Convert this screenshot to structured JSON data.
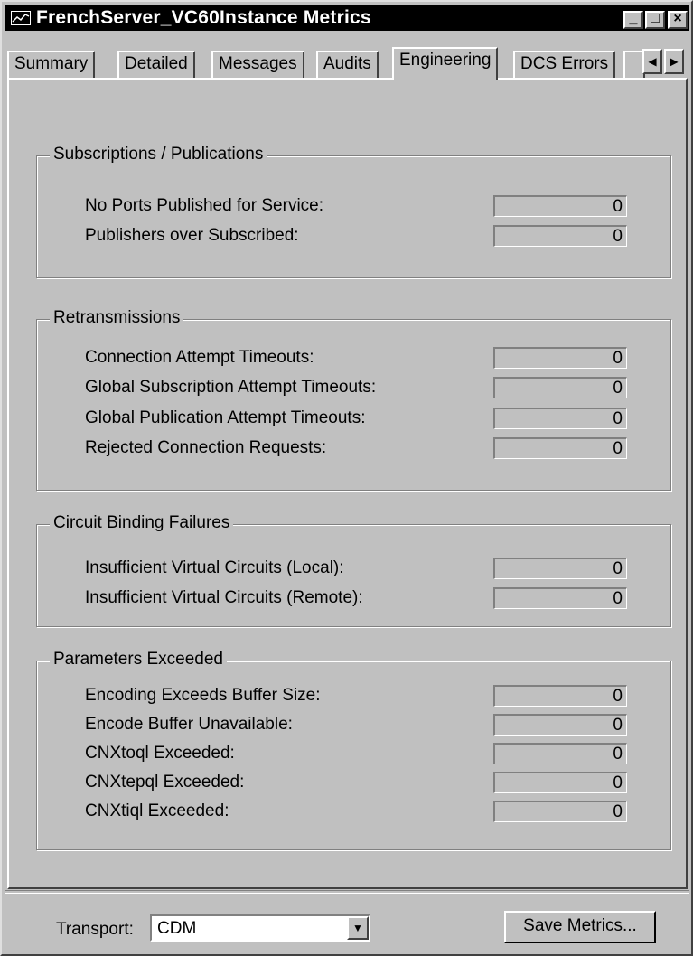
{
  "window": {
    "title": "FrenchServer_VC60Instance Metrics"
  },
  "titlebar_buttons": [
    "minimize-icon",
    "maximize-icon",
    "close-icon"
  ],
  "tabs": [
    {
      "label": "Summary"
    },
    {
      "label": "Detailed"
    },
    {
      "label": "Messages"
    },
    {
      "label": "Audits"
    },
    {
      "label": "Engineering",
      "active": true
    },
    {
      "label": "DCS Errors"
    }
  ],
  "groups": {
    "subscriptions": {
      "title": "Subscriptions / Publications",
      "rows": [
        {
          "label": "No Ports Published for Service:",
          "value": "0"
        },
        {
          "label": "Publishers over Subscribed:",
          "value": "0"
        }
      ]
    },
    "retransmissions": {
      "title": "Retransmissions",
      "rows": [
        {
          "label": "Connection Attempt Timeouts:",
          "value": "0"
        },
        {
          "label": "Global Subscription Attempt Timeouts:",
          "value": "0"
        },
        {
          "label": "Global Publication Attempt Timeouts:",
          "value": "0"
        },
        {
          "label": "Rejected Connection Requests:",
          "value": "0"
        }
      ]
    },
    "circuit": {
      "title": "Circuit Binding Failures",
      "rows": [
        {
          "label": "Insufficient Virtual Circuits (Local):",
          "value": "0"
        },
        {
          "label": "Insufficient Virtual Circuits (Remote):",
          "value": "0"
        }
      ]
    },
    "parameters": {
      "title": "Parameters Exceeded",
      "rows": [
        {
          "label": "Encoding Exceeds Buffer Size:",
          "value": "0"
        },
        {
          "label": "Encode Buffer Unavailable:",
          "value": "0"
        },
        {
          "label": "CNXtoql Exceeded:",
          "value": "0"
        },
        {
          "label": "CNXtepql Exceeded:",
          "value": "0"
        },
        {
          "label": "CNXtiql Exceeded:",
          "value": "0"
        }
      ]
    }
  },
  "footer": {
    "transport_label": "Transport:",
    "transport_value": "CDM",
    "save_label": "Save Metrics..."
  }
}
